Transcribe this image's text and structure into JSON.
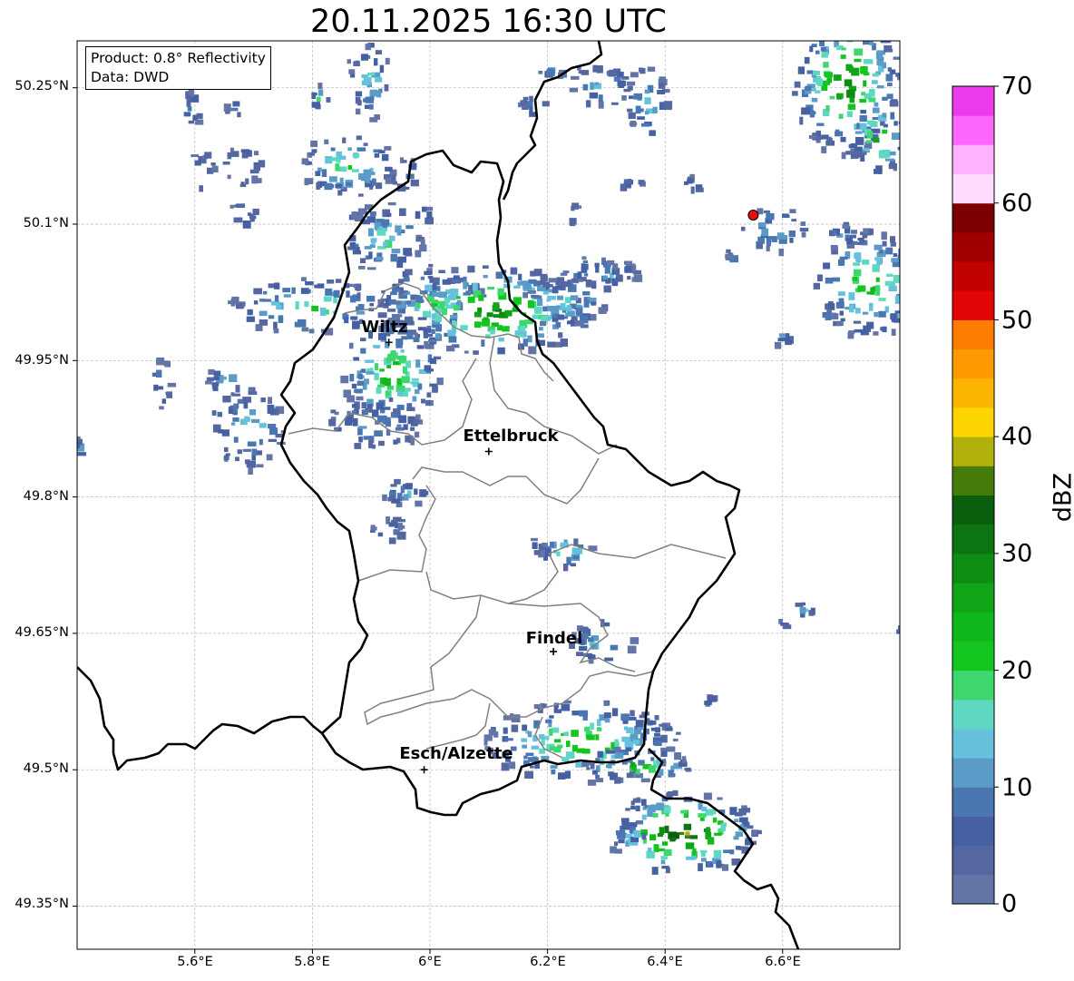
{
  "title": "20.11.2025 16:30 UTC",
  "info": {
    "product": "Product: 0.8° Reflectivity",
    "source": "Data: DWD"
  },
  "lat_ticks": [
    "50.25°N",
    "50.1°N",
    "49.95°N",
    "49.8°N",
    "49.65°N",
    "49.5°N",
    "49.35°N"
  ],
  "lon_ticks": [
    "5.6°E",
    "5.8°E",
    "6°E",
    "6.2°E",
    "6.4°E",
    "6.6°E"
  ],
  "cities": [
    {
      "name": "Wiltz",
      "lon": 5.93,
      "lat": 49.97
    },
    {
      "name": "Ettelbruck",
      "lon": 6.1,
      "lat": 49.85
    },
    {
      "name": "Findel",
      "lon": 6.21,
      "lat": 49.63
    },
    {
      "name": "Esch/Alzette",
      "lon": 5.99,
      "lat": 49.5
    }
  ],
  "radar_site": {
    "lon": 6.55,
    "lat": 50.11,
    "color": "#e8100c"
  },
  "colorbar": {
    "label": "dBZ",
    "ticks": [
      "0",
      "10",
      "20",
      "30",
      "40",
      "50",
      "60",
      "70"
    ],
    "colors": [
      "#6374a6",
      "#5467a0",
      "#4560a3",
      "#4a77b1",
      "#5b9bc7",
      "#66c2dc",
      "#5fd8c3",
      "#3ed76e",
      "#12c61f",
      "#11b81b",
      "#10a416",
      "#0f8c12",
      "#0c7412",
      "#0a5e0d",
      "#467b0a",
      "#b0b10a",
      "#fed500",
      "#fdb600",
      "#fe9b00",
      "#fe7d00",
      "#e30505",
      "#c10000",
      "#a00000",
      "#7c0000",
      "#ffdcff",
      "#ffb2ff",
      "#fe67fe",
      "#ec3aec"
    ]
  }
}
